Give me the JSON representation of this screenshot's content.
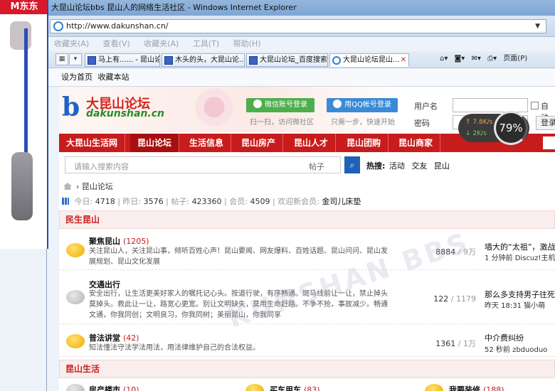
{
  "window": {
    "title": "大昆山论坛bbs 昆山人的网络生活社区 - Windows Internet Explorer"
  },
  "address": {
    "url": "http://www.dakunshan.cn/"
  },
  "menu": [
    "收藏夹(A)",
    "查看(V)",
    "收藏夹(A)",
    "工具(T)",
    "帮助(H)"
  ],
  "tabs": [
    {
      "label": "马上有...... - 昆山论..."
    },
    {
      "label": "木头的头，大昆山论..."
    },
    {
      "label": "大昆山论坛_百度搜索"
    },
    {
      "label": "大昆山论坛昆山..."
    }
  ],
  "commandbar": {
    "page_label": "页面(P)"
  },
  "favbar": {
    "set_home": "设为首页",
    "bookmark": "收藏本站"
  },
  "ad": {
    "banner_text": "M东东"
  },
  "header": {
    "logo_title": "大昆山论坛",
    "logo_url": "dakunshan.cn",
    "wechat_login": "微信账号登录",
    "wechat_sub": "扫一扫，访问微社区",
    "qq_login": "用QQ帐号登录",
    "qq_sub": "只需一步，快速开始",
    "user_label": "用户名",
    "pwd_label": "密码",
    "auto_login": "自动",
    "login_btn": "登录"
  },
  "nav": [
    "大昆山生活网",
    "昆山论坛",
    "生活信息",
    "昆山房产",
    "昆山人才",
    "昆山团购",
    "昆山商家"
  ],
  "search": {
    "placeholder": "请输入搜索内容",
    "type": "帖子",
    "hot_label": "热搜:",
    "hot": [
      "活动",
      "交友",
      "昆山"
    ]
  },
  "breadcrumb": {
    "current": "昆山论坛"
  },
  "stats": {
    "today_label": "今日:",
    "today": "4718",
    "yesterday_label": "昨日:",
    "yesterday": "3576",
    "posts_label": "帖子:",
    "posts": "423360",
    "members_label": "会员:",
    "members": "4509",
    "welcome_label": "欢迎新会员:",
    "new_member": "金司儿床垫"
  },
  "categories": {
    "first": "民生昆山",
    "second": "昆山生活"
  },
  "forums": [
    {
      "name": "聚焦昆山",
      "count": "(1205)",
      "desc": "关注昆山人，关注昆山事，倾听百姓心声！昆山要闻、网友爆料、百姓话题、昆山问问、昆山发展规划、昆山文化发展",
      "threads": "8884",
      "posts": "9万",
      "last_title": "墙大的“太祖”，激战群雄",
      "last_info": "1 分钟前 Discuz!主机"
    },
    {
      "name": "交通出行",
      "count": "",
      "desc": "安全出行，让生活更美好家人的嘱托记心头。按道行驶，有序畅通。斑马线前让一让，禁止掉头莫掉头。救此让一让，路宽心更宽。别让文明缺失，莫用生命赶路。不争不抢，事故减少。畅通文通，你我同创；文明良习，你我同树；美丽昆山，你我同享",
      "threads": "122",
      "posts": "1179",
      "last_title": "那么多支持男子往死里打",
      "last_info": "昨天 18:31 猫小萌"
    },
    {
      "name": "普法讲堂",
      "count": "(42)",
      "desc": "知法懂法守法学法用法，用法律维护自己的合法权益。",
      "threads": "1361",
      "posts": "1万",
      "last_title": "中介费纠纷",
      "last_info": "52 秒前 zbduoduo"
    }
  ],
  "row3": [
    {
      "name": "房产楼市",
      "count": "(10)"
    },
    {
      "name": "买车用车",
      "count": "(83)"
    },
    {
      "name": "我要装修",
      "count": "(188)"
    }
  ],
  "watermark": "KUNSHAN BBS",
  "network": {
    "up": "7.8K/s",
    "down": "2K/s",
    "percent": "79%"
  }
}
